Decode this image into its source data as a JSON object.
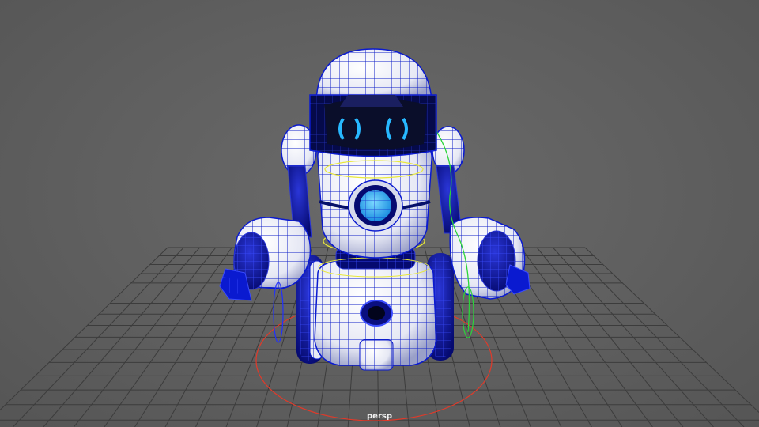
{
  "viewport": {
    "camera_label": "persp",
    "background_color": "#5d5d5d",
    "grid_color": "#3c3c3c",
    "wireframe_color": "#0a1ad0",
    "selection_colors": {
      "rotate_ring": "#e03a2a",
      "arm_control": "#2bd43a",
      "waist_control": "#e8e83a"
    },
    "accent_glow_color": "#27b8ff"
  },
  "model": {
    "icons": [
      "robot-model",
      "ground-grid",
      "root-control-curve"
    ]
  }
}
